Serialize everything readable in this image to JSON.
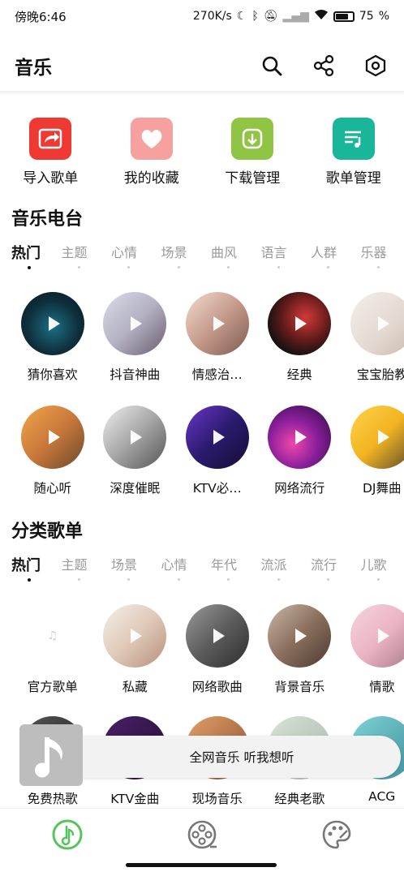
{
  "status": {
    "time": "傍晚6:46",
    "speed": "270K/s",
    "battery": "75"
  },
  "header": {
    "title": "音乐",
    "icons": [
      "search-icon",
      "share-icon",
      "settings-icon"
    ]
  },
  "quick_actions": [
    {
      "label": "导入歌单",
      "icon": "import-icon",
      "color": "#ee3a33"
    },
    {
      "label": "我的收藏",
      "icon": "heart-icon",
      "color": "#f6a1a0"
    },
    {
      "label": "下载管理",
      "icon": "download-icon",
      "color": "#8fc444"
    },
    {
      "label": "歌单管理",
      "icon": "playlist-icon",
      "color": "#1ab69a"
    }
  ],
  "radio": {
    "title": "音乐电台",
    "tabs": [
      "热门",
      "主题",
      "心情",
      "场景",
      "曲风",
      "语言",
      "人群",
      "乐器"
    ],
    "items": [
      {
        "label": "猜你喜欢",
        "bg": "radial-gradient(circle at 50% 55%, #1d6f86 0%, #0e2f3c 55%, #07161c 100%)"
      },
      {
        "label": "抖音神曲",
        "bg": "linear-gradient(135deg,#dcdce8 0%, #b3b1c2 50%, #6b5b70 100%)"
      },
      {
        "label": "情感治…",
        "bg": "linear-gradient(135deg,#f3dcd0 0%, #c59a8b 50%, #7c5a4f 100%)"
      },
      {
        "label": "经典",
        "bg": "radial-gradient(circle at 60% 40%, #d23a38 0%, #5e1a1a 45%, #111 75%)"
      },
      {
        "label": "宝宝胎教",
        "bg": "linear-gradient(135deg,#f3efeb 0%, #e3d8d0 60%, #c9b9ad 100%)"
      },
      {
        "label": "随心听",
        "bg": "linear-gradient(135deg,#f2a54a 0%, #c9783b 50%, #6a4a2d 100%)"
      },
      {
        "label": "深度催眠",
        "bg": "linear-gradient(135deg,#efefef 0%, #a5a5a5 50%, #555 100%)"
      },
      {
        "label": "KTV必…",
        "bg": "linear-gradient(135deg,#6a37c9 0%, #2b1a6e 50%, #160d33 100%)"
      },
      {
        "label": "网络流行",
        "bg": "radial-gradient(circle at 40% 60%, #f048a9 0%, #8a1f9c 45%, #2a0b3b 100%)"
      },
      {
        "label": "DJ舞曲",
        "bg": "linear-gradient(135deg,#ffd34a 0%, #f2b321 50%, #5a4a2a 100%)"
      }
    ]
  },
  "category": {
    "title": "分类歌单",
    "tabs": [
      "热门",
      "主题",
      "场景",
      "心情",
      "年代",
      "流派",
      "流行",
      "儿歌"
    ],
    "items": [
      {
        "label": "官方歌单",
        "bg": "#ffffff"
      },
      {
        "label": "私藏",
        "bg": "linear-gradient(135deg,#f4efe9 0%, #e0c9b8 50%, #b58f7b 100%)"
      },
      {
        "label": "网络歌曲",
        "bg": "linear-gradient(135deg,#9b9b9b 0%, #5c5c5c 50%, #2e2e2e 100%)"
      },
      {
        "label": "背景音乐",
        "bg": "linear-gradient(135deg,#c9b7a7 0%, #8b6f5d 50%, #4b3a31 100%)"
      },
      {
        "label": "情歌",
        "bg": "linear-gradient(135deg,#f7d3de 0%, #ebb5c4 50%, #a87b8b 100%)"
      },
      {
        "label": "免费热歌",
        "bg": "linear-gradient(135deg,#555 0%, #222 100%)"
      },
      {
        "label": "KTV金曲",
        "bg": "linear-gradient(135deg,#4a1f69 0%, #22102f 100%)"
      },
      {
        "label": "现场音乐",
        "bg": "linear-gradient(135deg,#e2a169 0%, #8a4d2e 100%)"
      },
      {
        "label": "经典老歌",
        "bg": "linear-gradient(135deg,#d8e2d9 0%, #a7b7ab 100%)"
      },
      {
        "label": "ACG",
        "bg": "linear-gradient(135deg,#7fd3d6 0%, #3f8e9a 100%)"
      }
    ]
  },
  "miniplayer": {
    "text": "全网音乐 听我想听"
  },
  "bottom_nav": [
    {
      "icon": "music-note-icon",
      "active": true
    },
    {
      "icon": "film-reel-icon",
      "active": false
    },
    {
      "icon": "palette-icon",
      "active": false
    }
  ],
  "colors": {
    "accent": "#55c45a"
  }
}
